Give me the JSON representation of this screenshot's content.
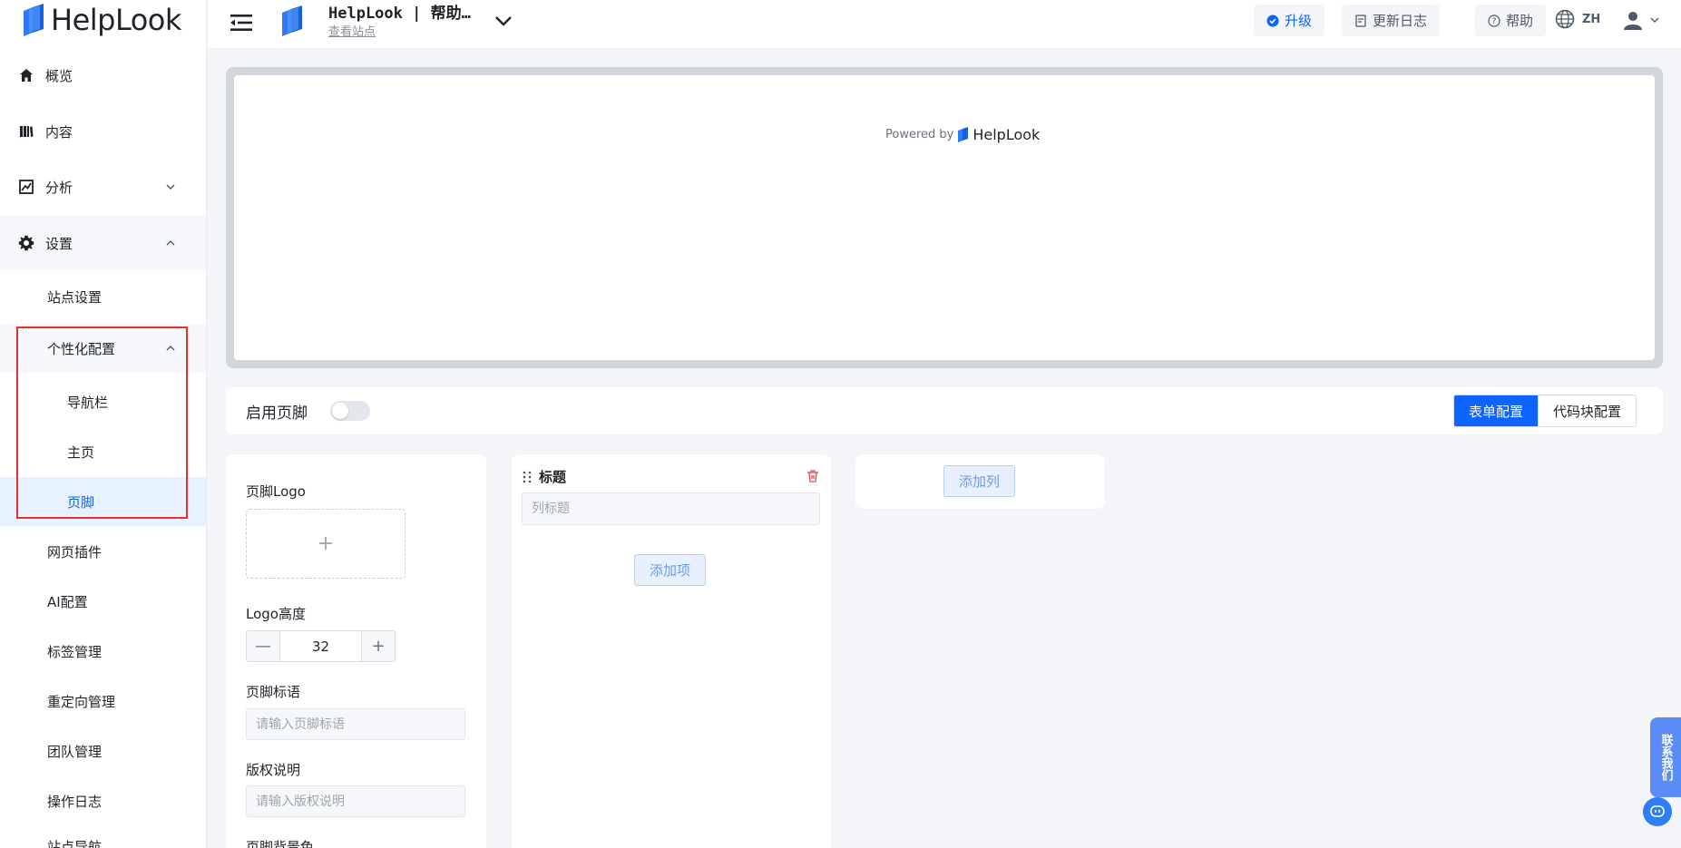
{
  "brand": {
    "name": "HelpLook"
  },
  "sidebar": {
    "items": [
      {
        "label": "概览",
        "icon": "home-icon"
      },
      {
        "label": "内容",
        "icon": "book-icon"
      },
      {
        "label": "分析",
        "icon": "chart-icon"
      },
      {
        "label": "设置",
        "icon": "gear-icon"
      }
    ],
    "settings_sub": {
      "site": "站点设置",
      "personalize": "个性化配置",
      "navbar": "导航栏",
      "home": "主页",
      "footer": "页脚",
      "plugins": "网页插件",
      "ai": "AI配置",
      "tags": "标签管理",
      "redirect": "重定向管理",
      "team": "团队管理",
      "logs": "操作日志",
      "export": "站点导航"
    }
  },
  "header": {
    "site_title": "HelpLook | 帮助…",
    "site_link": "查看站点",
    "upgrade": "升级",
    "changelog": "更新日志",
    "help": "帮助",
    "lang": "ZH"
  },
  "preview": {
    "powered_by": "Powered by",
    "brand": "HelpLook"
  },
  "footer_config": {
    "enable_label": "启用页脚",
    "enabled": false,
    "tabs": {
      "form": "表单配置",
      "code": "代码块配置"
    }
  },
  "form": {
    "logo_label": "页脚Logo",
    "uploader_plus": "+",
    "height_label": "Logo高度",
    "height_value": "32",
    "minus": "—",
    "plus": "+",
    "slogan_label": "页脚标语",
    "slogan_placeholder": "请输入页脚标语",
    "copyright_label": "版权说明",
    "copyright_placeholder": "请输入版权说明",
    "bgcolor_label": "页脚背景色"
  },
  "column": {
    "title": "标题",
    "title_placeholder": "列标题",
    "add_item": "添加项"
  },
  "add_column": "添加列",
  "floating": {
    "contact": "联系我们"
  },
  "colors": {
    "accent": "#0f63ff",
    "highlight": "#e8302a"
  }
}
